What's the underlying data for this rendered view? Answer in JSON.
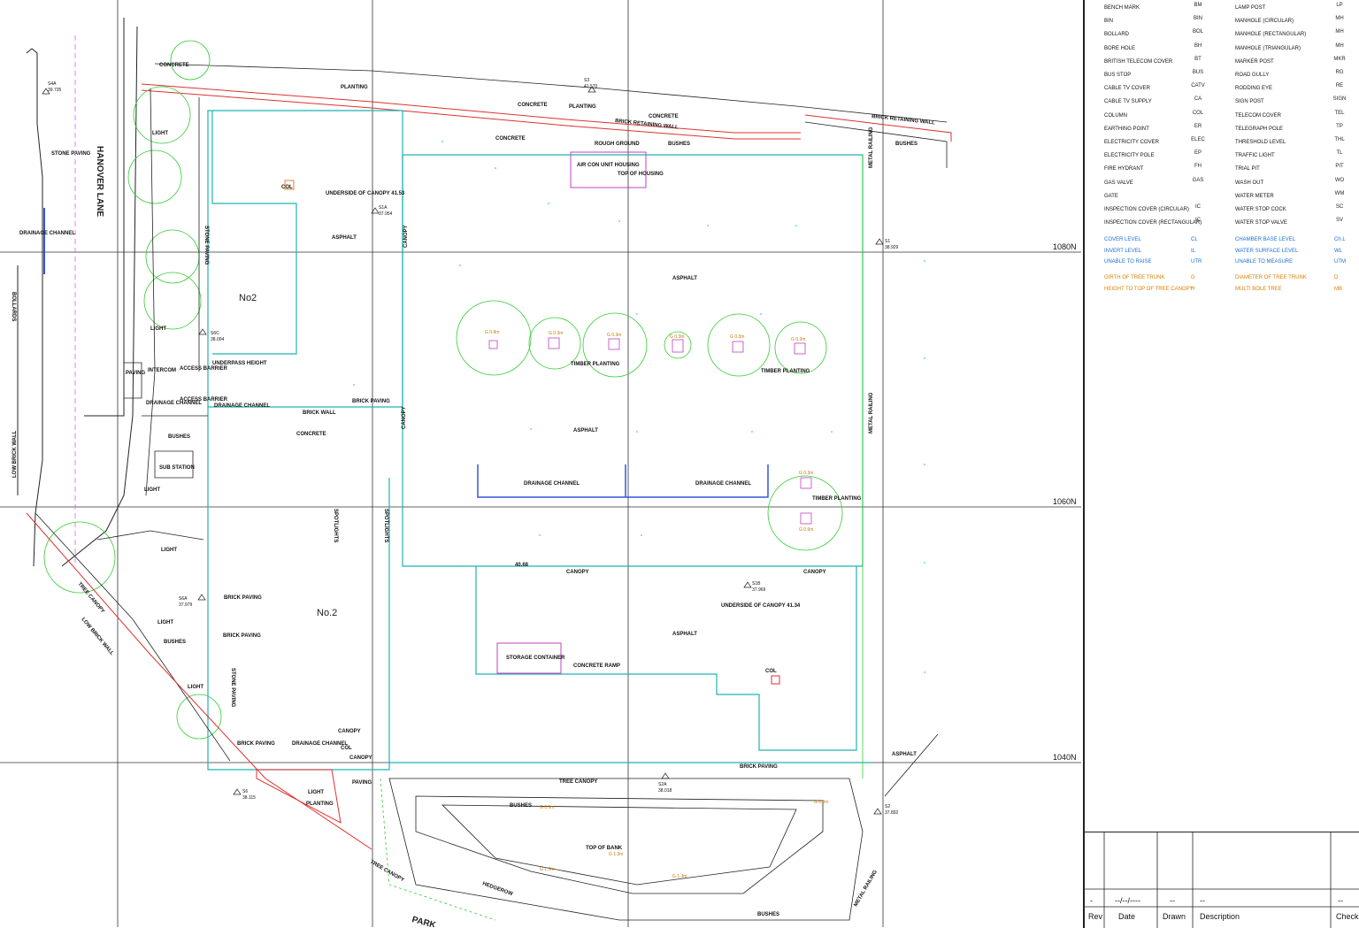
{
  "plan": {
    "road_name": "HANOVER LANE",
    "road_name_bottom": "PARK",
    "building_labels": [
      "No2",
      "No.2"
    ],
    "grid_labels": [
      "1080N",
      "1060N",
      "1040N"
    ],
    "stations": [
      {
        "name": "S4A",
        "level": "39.735"
      },
      {
        "name": "S3",
        "level": "41.570"
      },
      {
        "name": "S1A",
        "level": "37.954"
      },
      {
        "name": "S1",
        "level": "38.929"
      },
      {
        "name": "S6C",
        "level": "38.004"
      },
      {
        "name": "S6A",
        "level": "37.979"
      },
      {
        "name": "S1B",
        "level": "37.969"
      },
      {
        "name": "S6",
        "level": "38.115"
      },
      {
        "name": "S2A",
        "level": "38.018"
      },
      {
        "name": "S2",
        "level": "37.892"
      }
    ],
    "labels": {
      "concrete": "CONCRETE",
      "planting": "PLANTING",
      "brick_retaining_wall": "BRICK RETAINING WALL",
      "bushes": "BUSHES",
      "rough_ground": "ROUGH GROUND",
      "air_con": "AIR CON UNIT HOUSING",
      "top_of_housing": "TOP OF HOUSING",
      "underside_canopy_a": "UNDERSIDE OF CANOPY 41.53",
      "asphalt": "ASPHALT",
      "stone_paving": "STONE PAVING",
      "drainage_channel": "DRAINAGE CHANNEL",
      "timber_planting": "TIMBER PLANTING",
      "canopy": "CANOPY",
      "underside_canopy_b": "UNDERSIDE OF CANOPY 41.34",
      "storage_container": "STORAGE CONTAINER",
      "concrete_ramp": "CONCRETE RAMP",
      "brick_paving": "BRICK PAVING",
      "brick_wall": "BRICK WALL",
      "sub_station": "SUB STATION",
      "intercom": "INTERCOM",
      "access_barrier": "ACCESS BARRIER",
      "underpass_height": "UNDERPASS HEIGHT",
      "light": "LIGHT",
      "tree_canopy": "TREE CANOPY",
      "top_of_bank": "TOP OF BANK",
      "metal_railing": "METAL RAILING",
      "low_brick_wall": "LOW BRICK WALL",
      "hedgerow": "HEDGEROW",
      "spotlights": "SPOTLIGHTS",
      "paving": "PAVING",
      "col": "COL",
      "bollards": "BOLLARDS",
      "pipe": "PIPE",
      "post": "POST",
      "canopy_level": "40.68"
    },
    "tree_tags": [
      "G 0.3m",
      "G 0.6m",
      "G 0.8m",
      "G 1.3m",
      "G 0.9m"
    ]
  },
  "legend": {
    "symbols": [
      {
        "left": "BENCH MARK",
        "left_sym": "BM",
        "right": "LAMP POST",
        "right_sym": "LP"
      },
      {
        "left": "BIN",
        "left_sym": "BIN",
        "right": "MANHOLE (CIRCULAR)",
        "right_sym": "MH"
      },
      {
        "left": "BOLLARD",
        "left_sym": "BOL",
        "right": "MANHOLE (RECTANGULAR)",
        "right_sym": "MH"
      },
      {
        "left": "BORE HOLE",
        "left_sym": "BH",
        "right": "MANHOLE (TRIANGULAR)",
        "right_sym": "MH"
      },
      {
        "left": "BRITISH TELECOM COVER",
        "left_sym": "BT",
        "right": "MARKER POST",
        "right_sym": "MKR"
      },
      {
        "left": "BUS STOP",
        "left_sym": "BUS",
        "right": "ROAD GULLY",
        "right_sym": "RG"
      },
      {
        "left": "CABLE TV COVER",
        "left_sym": "CATV",
        "right": "RODDING EYE",
        "right_sym": "RE"
      },
      {
        "left": "CABLE TV SUPPLY",
        "left_sym": "CA",
        "right": "SIGN POST",
        "right_sym": "SIGN"
      },
      {
        "left": "COLUMN",
        "left_sym": "COL",
        "right": "TELECOM COVER",
        "right_sym": "TEL"
      },
      {
        "left": "EARTHING POINT",
        "left_sym": "ER",
        "right": "TELEGRAPH POLE",
        "right_sym": "TP"
      },
      {
        "left": "ELECTRICITY COVER",
        "left_sym": "ELEC",
        "right": "THRESHOLD LEVEL",
        "right_sym": "THL"
      },
      {
        "left": "ELECTRICITY POLE",
        "left_sym": "EP",
        "right": "TRAFFIC LIGHT",
        "right_sym": "TL"
      },
      {
        "left": "FIRE HYDRANT",
        "left_sym": "FH",
        "right": "TRIAL PIT",
        "right_sym": "PIT"
      },
      {
        "left": "GAS VALVE",
        "left_sym": "GAS",
        "right": "WASH OUT",
        "right_sym": "WO"
      },
      {
        "left": "GATE",
        "left_sym": "",
        "right": "WATER METER",
        "right_sym": "WM"
      },
      {
        "left": "INSPECTION COVER (CIRCULAR)",
        "left_sym": "IC",
        "right": "WATER STOP COCK",
        "right_sym": "SC"
      },
      {
        "left": "INSPECTION COVER (RECTANGULAR)",
        "left_sym": "IC",
        "right": "WATER STOP VALVE",
        "right_sym": "SV"
      }
    ],
    "abbreviations_blue": [
      {
        "left": "COVER LEVEL",
        "left_abbr": "CL",
        "right": "CHAMBER BASE LEVEL",
        "right_abbr": "Ch.L"
      },
      {
        "left": "INVERT LEVEL",
        "left_abbr": "IL",
        "right": "WATER SURFACE LEVEL",
        "right_abbr": "WL"
      },
      {
        "left": "UNABLE TO RAISE",
        "left_abbr": "UTR",
        "right": "UNABLE TO MEASURE",
        "right_abbr": "UTM"
      }
    ],
    "abbreviations_orange": [
      {
        "left": "GIRTH OF TREE TRUNK",
        "left_abbr": "G",
        "right": "DIAMETER OF TREE TRUNK",
        "right_abbr": "D"
      },
      {
        "left": "HEIGHT TO TOP OF TREE CANOPY",
        "left_abbr": "H",
        "right": "MULTI BOLE TREE",
        "right_abbr": "MB"
      }
    ]
  },
  "revision": {
    "rev": "-",
    "date": "--/--/----",
    "drawn": "--",
    "description": "--",
    "check": "--",
    "headers": {
      "rev": "Rev",
      "date": "Date",
      "drawn": "Drawn",
      "description": "Description",
      "check": "Check"
    }
  },
  "colors": {
    "building_outline": "#1fb5b0",
    "wall_red": "#e03030",
    "tree_green": "#33cc33",
    "level_blue": "#1ab0e8",
    "pink_line": "#e060e0",
    "tree_tag_orange": "#c47a00"
  }
}
